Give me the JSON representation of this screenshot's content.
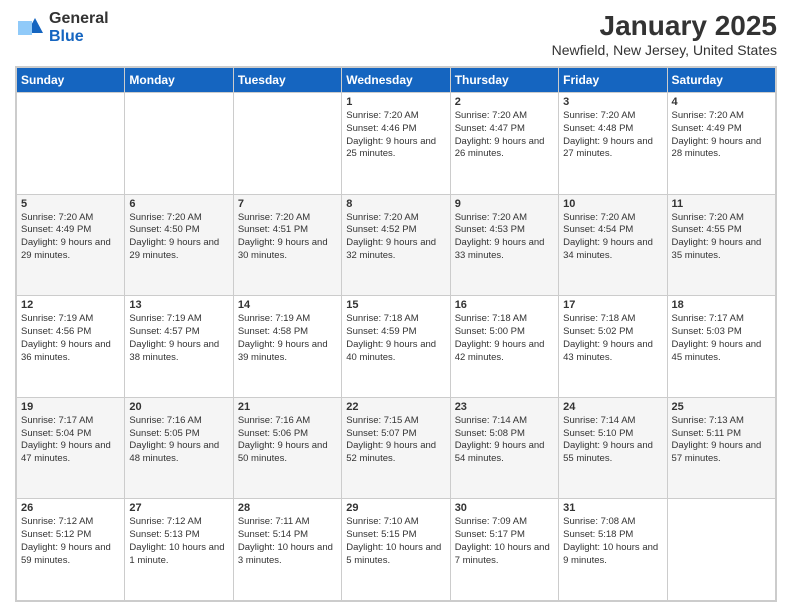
{
  "header": {
    "logo_general": "General",
    "logo_blue": "Blue",
    "title": "January 2025",
    "subtitle": "Newfield, New Jersey, United States"
  },
  "calendar": {
    "days_of_week": [
      "Sunday",
      "Monday",
      "Tuesday",
      "Wednesday",
      "Thursday",
      "Friday",
      "Saturday"
    ],
    "weeks": [
      {
        "cells": [
          {
            "day": "",
            "empty": true
          },
          {
            "day": "",
            "empty": true
          },
          {
            "day": "",
            "empty": true
          },
          {
            "day": "1",
            "sunrise": "7:20 AM",
            "sunset": "4:46 PM",
            "daylight": "9 hours and 25 minutes."
          },
          {
            "day": "2",
            "sunrise": "7:20 AM",
            "sunset": "4:47 PM",
            "daylight": "9 hours and 26 minutes."
          },
          {
            "day": "3",
            "sunrise": "7:20 AM",
            "sunset": "4:48 PM",
            "daylight": "9 hours and 27 minutes."
          },
          {
            "day": "4",
            "sunrise": "7:20 AM",
            "sunset": "4:49 PM",
            "daylight": "9 hours and 28 minutes."
          }
        ]
      },
      {
        "cells": [
          {
            "day": "5",
            "sunrise": "7:20 AM",
            "sunset": "4:49 PM",
            "daylight": "9 hours and 29 minutes."
          },
          {
            "day": "6",
            "sunrise": "7:20 AM",
            "sunset": "4:50 PM",
            "daylight": "9 hours and 29 minutes."
          },
          {
            "day": "7",
            "sunrise": "7:20 AM",
            "sunset": "4:51 PM",
            "daylight": "9 hours and 30 minutes."
          },
          {
            "day": "8",
            "sunrise": "7:20 AM",
            "sunset": "4:52 PM",
            "daylight": "9 hours and 32 minutes."
          },
          {
            "day": "9",
            "sunrise": "7:20 AM",
            "sunset": "4:53 PM",
            "daylight": "9 hours and 33 minutes."
          },
          {
            "day": "10",
            "sunrise": "7:20 AM",
            "sunset": "4:54 PM",
            "daylight": "9 hours and 34 minutes."
          },
          {
            "day": "11",
            "sunrise": "7:20 AM",
            "sunset": "4:55 PM",
            "daylight": "9 hours and 35 minutes."
          }
        ]
      },
      {
        "cells": [
          {
            "day": "12",
            "sunrise": "7:19 AM",
            "sunset": "4:56 PM",
            "daylight": "9 hours and 36 minutes."
          },
          {
            "day": "13",
            "sunrise": "7:19 AM",
            "sunset": "4:57 PM",
            "daylight": "9 hours and 38 minutes."
          },
          {
            "day": "14",
            "sunrise": "7:19 AM",
            "sunset": "4:58 PM",
            "daylight": "9 hours and 39 minutes."
          },
          {
            "day": "15",
            "sunrise": "7:18 AM",
            "sunset": "4:59 PM",
            "daylight": "9 hours and 40 minutes."
          },
          {
            "day": "16",
            "sunrise": "7:18 AM",
            "sunset": "5:00 PM",
            "daylight": "9 hours and 42 minutes."
          },
          {
            "day": "17",
            "sunrise": "7:18 AM",
            "sunset": "5:02 PM",
            "daylight": "9 hours and 43 minutes."
          },
          {
            "day": "18",
            "sunrise": "7:17 AM",
            "sunset": "5:03 PM",
            "daylight": "9 hours and 45 minutes."
          }
        ]
      },
      {
        "cells": [
          {
            "day": "19",
            "sunrise": "7:17 AM",
            "sunset": "5:04 PM",
            "daylight": "9 hours and 47 minutes."
          },
          {
            "day": "20",
            "sunrise": "7:16 AM",
            "sunset": "5:05 PM",
            "daylight": "9 hours and 48 minutes."
          },
          {
            "day": "21",
            "sunrise": "7:16 AM",
            "sunset": "5:06 PM",
            "daylight": "9 hours and 50 minutes."
          },
          {
            "day": "22",
            "sunrise": "7:15 AM",
            "sunset": "5:07 PM",
            "daylight": "9 hours and 52 minutes."
          },
          {
            "day": "23",
            "sunrise": "7:14 AM",
            "sunset": "5:08 PM",
            "daylight": "9 hours and 54 minutes."
          },
          {
            "day": "24",
            "sunrise": "7:14 AM",
            "sunset": "5:10 PM",
            "daylight": "9 hours and 55 minutes."
          },
          {
            "day": "25",
            "sunrise": "7:13 AM",
            "sunset": "5:11 PM",
            "daylight": "9 hours and 57 minutes."
          }
        ]
      },
      {
        "cells": [
          {
            "day": "26",
            "sunrise": "7:12 AM",
            "sunset": "5:12 PM",
            "daylight": "9 hours and 59 minutes."
          },
          {
            "day": "27",
            "sunrise": "7:12 AM",
            "sunset": "5:13 PM",
            "daylight": "10 hours and 1 minute."
          },
          {
            "day": "28",
            "sunrise": "7:11 AM",
            "sunset": "5:14 PM",
            "daylight": "10 hours and 3 minutes."
          },
          {
            "day": "29",
            "sunrise": "7:10 AM",
            "sunset": "5:15 PM",
            "daylight": "10 hours and 5 minutes."
          },
          {
            "day": "30",
            "sunrise": "7:09 AM",
            "sunset": "5:17 PM",
            "daylight": "10 hours and 7 minutes."
          },
          {
            "day": "31",
            "sunrise": "7:08 AM",
            "sunset": "5:18 PM",
            "daylight": "10 hours and 9 minutes."
          },
          {
            "day": "",
            "empty": true
          }
        ]
      }
    ]
  }
}
